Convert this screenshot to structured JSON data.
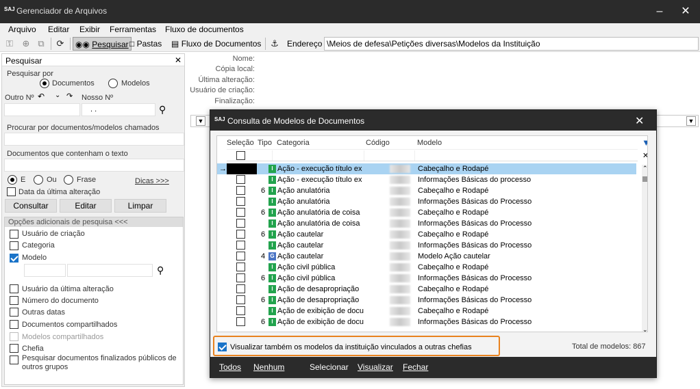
{
  "titlebar": {
    "logo": "SAJ",
    "title": "Gerenciador de Arquivos",
    "minimize": "–",
    "close": "✕"
  },
  "menu": [
    "Arquivo",
    "Editar",
    "Exibir",
    "Ferramentas",
    "Fluxo de documentos"
  ],
  "toolbar": {
    "pesquisar": "Pesquisar",
    "pastas": "Pastas",
    "fluxo": "Fluxo de Documentos",
    "endereco_label": "Endereço",
    "endereco": "\\Meios de defesa\\Petições diversas\\Modelos da Instituição"
  },
  "left": {
    "panel_title": "Pesquisar",
    "close": "✕",
    "pesquisar_por": "Pesquisar por",
    "opt_documentos": "Documentos",
    "opt_modelos": "Modelos",
    "outro_no": "Outro Nº",
    "nosso_no": "Nosso Nº",
    "nosso_value": ". .",
    "procurar_label": "Procurar por documentos/modelos chamados",
    "contenham_label": "Documentos que contenham o texto",
    "op_e": "E",
    "op_ou": "Ou",
    "op_frase": "Frase",
    "dicas": "Dicas >>>",
    "data_ultima": "Data da última alteração",
    "btn_consultar": "Consultar",
    "btn_editar": "Editar",
    "btn_limpar": "Limpar",
    "opcoes_title": "Opções adicionais de pesquisa <<<",
    "opts": [
      "Usuário de criação",
      "Categoria",
      "Modelo"
    ],
    "opts2": [
      "Usuário da última alteração",
      "Número do documento",
      "Outras datas",
      "Documentos compartilhados",
      "Modelos compartilhados",
      "Chefia"
    ],
    "pesquisar_finalizados": "Pesquisar documentos finalizados públicos de outros grupos"
  },
  "details": [
    "Nome:",
    "Cópia local:",
    "Última alteração:",
    "Usuário de criação:",
    "Finalização:"
  ],
  "dialog": {
    "logo": "SAJ",
    "title": "Consulta de Modelos de Documentos",
    "close": "✕",
    "col_selecao": "Seleção",
    "col_tipo": "Tipo",
    "col_categoria": "Categoria",
    "col_codigo": "Código",
    "col_modelo": "Modelo",
    "rows": [
      {
        "num": "",
        "tipo": "I",
        "categoria": "Ação - execução título  ex",
        "modelo": "Cabeçalho e Rodapé"
      },
      {
        "num": "",
        "tipo": "I",
        "categoria": "Ação - execução título  ex",
        "modelo": "Informações Básicas do processo"
      },
      {
        "num": "6",
        "tipo": "I",
        "categoria": "Ação anulatória",
        "modelo": "Cabeçalho e Rodapé"
      },
      {
        "num": "",
        "tipo": "I",
        "categoria": "Ação anulatória",
        "modelo": "Informações Básicas do Processo"
      },
      {
        "num": "6",
        "tipo": "I",
        "categoria": "Ação anulatória de coisa",
        "modelo": "Cabeçalho e Rodapé"
      },
      {
        "num": "",
        "tipo": "I",
        "categoria": "Ação anulatória de coisa",
        "modelo": "Informações Básicas do Processo"
      },
      {
        "num": "6",
        "tipo": "I",
        "categoria": "Ação cautelar",
        "modelo": "Cabeçalho e Rodapé"
      },
      {
        "num": "",
        "tipo": "I",
        "categoria": "Ação cautelar",
        "modelo": "Informações Básicas do Processo"
      },
      {
        "num": "4",
        "tipo": "G",
        "categoria": "Ação cautelar",
        "modelo": "Modelo Ação cautelar"
      },
      {
        "num": "",
        "tipo": "I",
        "categoria": "Ação civil pública",
        "modelo": "Cabeçalho e Rodapé"
      },
      {
        "num": "6",
        "tipo": "I",
        "categoria": "Ação civil pública",
        "modelo": "Informações Básicas do Processo"
      },
      {
        "num": "",
        "tipo": "I",
        "categoria": "Ação de desapropriação",
        "modelo": "Cabeçalho e Rodapé"
      },
      {
        "num": "6",
        "tipo": "I",
        "categoria": "Ação de desapropriação",
        "modelo": "Informações Básicas do Processo"
      },
      {
        "num": "",
        "tipo": "I",
        "categoria": "Ação de exibição de docu",
        "modelo": "Cabeçalho e Rodapé"
      },
      {
        "num": "6",
        "tipo": "I",
        "categoria": "Ação de exibição de docu",
        "modelo": "Informações Básicas do Processo"
      }
    ],
    "visualizar_tambem": "Visualizar também os modelos da instituição vinculados a outras chefias",
    "total": "Total de modelos: 867",
    "btn_todos": "Todos",
    "btn_nenhum": "Nenhum",
    "btn_selecionar": "Selecionar",
    "btn_visualizar": "Visualizar",
    "btn_fechar": "Fechar"
  }
}
